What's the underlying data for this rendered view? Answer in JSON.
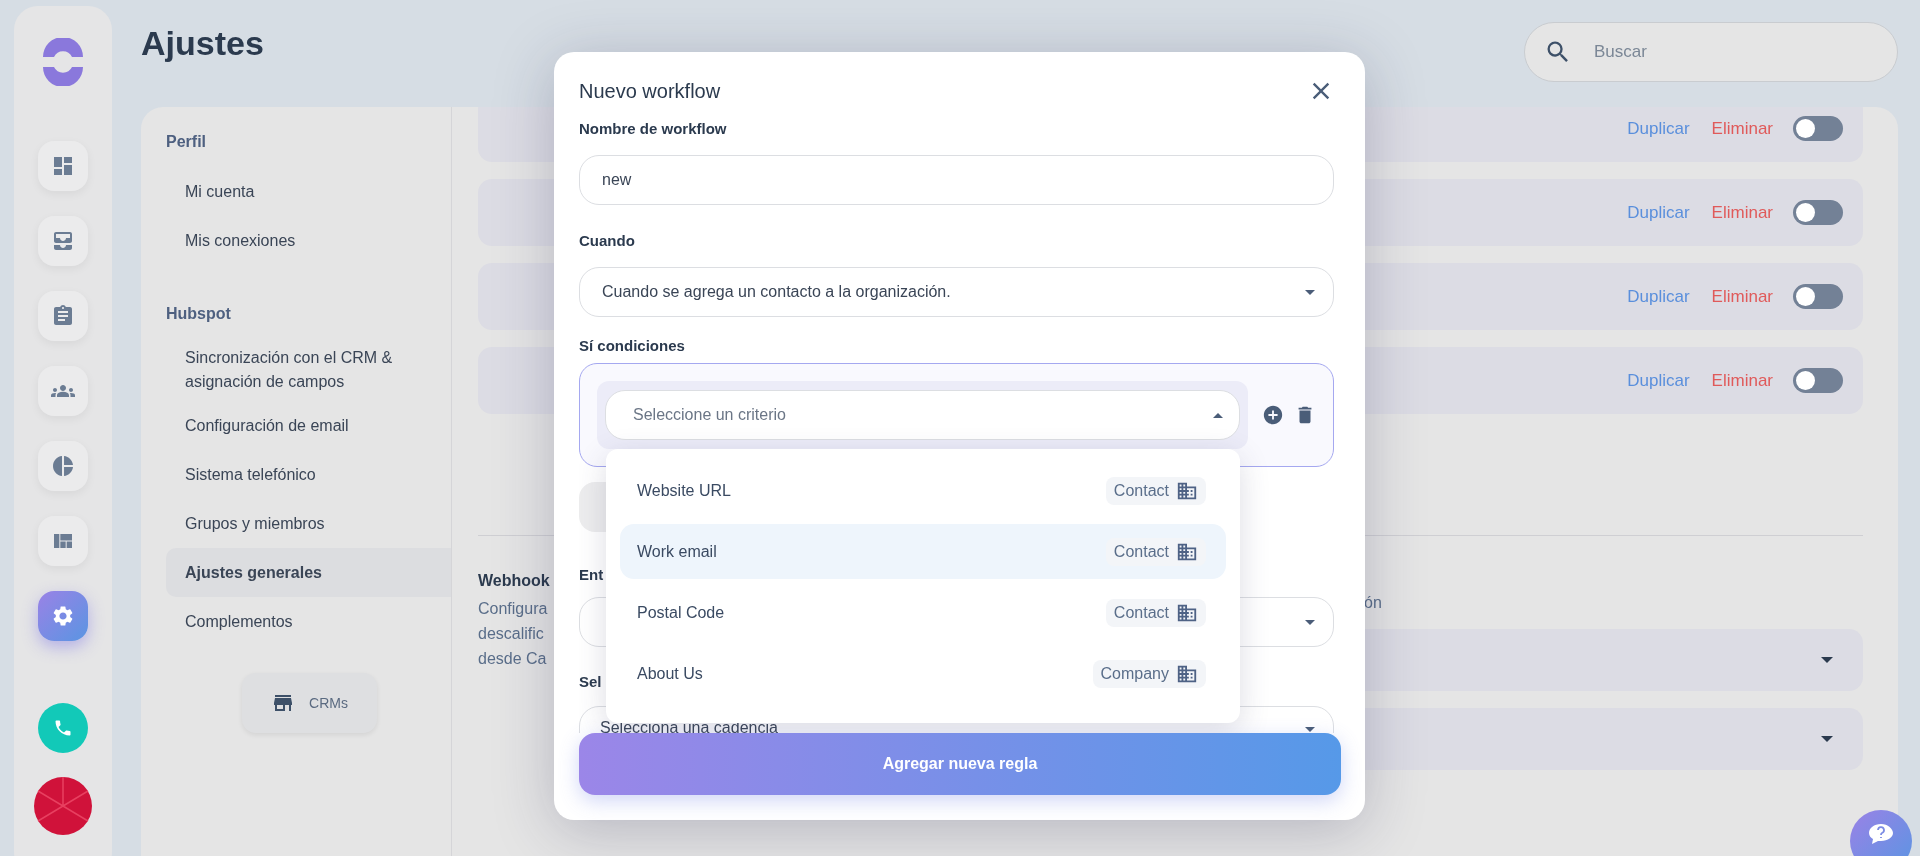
{
  "rail": {
    "items": [
      {
        "kind": "dashboard",
        "selected": false
      },
      {
        "kind": "inbox",
        "selected": false
      },
      {
        "kind": "tasks",
        "selected": false
      },
      {
        "kind": "team",
        "selected": false
      },
      {
        "kind": "reports",
        "selected": false
      },
      {
        "kind": "layout",
        "selected": false
      },
      {
        "kind": "settings",
        "selected": true
      }
    ]
  },
  "page": {
    "title": "Ajustes"
  },
  "search": {
    "placeholder": "Buscar"
  },
  "settings_nav": {
    "sections": [
      {
        "title": "Perfil",
        "items": [
          {
            "label": "Mi cuenta",
            "selected": false
          },
          {
            "label": "Mis conexiones",
            "selected": false
          }
        ]
      },
      {
        "title": "Hubspot",
        "items": [
          {
            "label": "Sincronización con el CRM & asignación de campos",
            "selected": false
          },
          {
            "label": "Configuración de email",
            "selected": false
          },
          {
            "label": "Sistema telefónico",
            "selected": false
          },
          {
            "label": "Grupos y miembros",
            "selected": false
          },
          {
            "label": "Ajustes generales",
            "selected": true
          },
          {
            "label": "Complementos",
            "selected": false
          }
        ]
      }
    ],
    "crm_button": "CRMs"
  },
  "workflows": [
    {
      "duplicate": "Duplicar",
      "delete": "Eliminar",
      "on": false
    },
    {
      "duplicate": "Duplicar",
      "delete": "Eliminar",
      "on": false
    },
    {
      "duplicate": "Duplicar",
      "delete": "Eliminar",
      "on": false
    },
    {
      "duplicate": "Duplicar",
      "delete": "Eliminar",
      "on": false
    }
  ],
  "webhook": {
    "title": "Webhook",
    "description_lines": [
      "Configura",
      "descalific",
      "desde Ca"
    ],
    "right_text": "ón",
    "dropdowns": [
      {
        "kind": "select"
      },
      {
        "kind": "select"
      }
    ]
  },
  "modal": {
    "title": "Nuevo workflow",
    "name_label": "Nombre de workflow",
    "name_value": "new",
    "when_label": "Cuando",
    "when_value": "Cuando se agrega un contacto a la organización.",
    "conditions_label": "Sí condiciones",
    "criterion_placeholder": "Seleccione un criterio",
    "criteria_options": [
      {
        "label": "Website URL",
        "tag": "Contact",
        "highlighted": false
      },
      {
        "label": "Work email",
        "tag": "Contact",
        "highlighted": true
      },
      {
        "label": "Postal Code",
        "tag": "Contact",
        "highlighted": false
      },
      {
        "label": "About Us",
        "tag": "Company",
        "highlighted": false
      }
    ],
    "entity_label": "Ent",
    "cadence_label": "Sel",
    "cadence_value": "Selecciona una cadencia",
    "submit": "Agregar nueva regla"
  }
}
